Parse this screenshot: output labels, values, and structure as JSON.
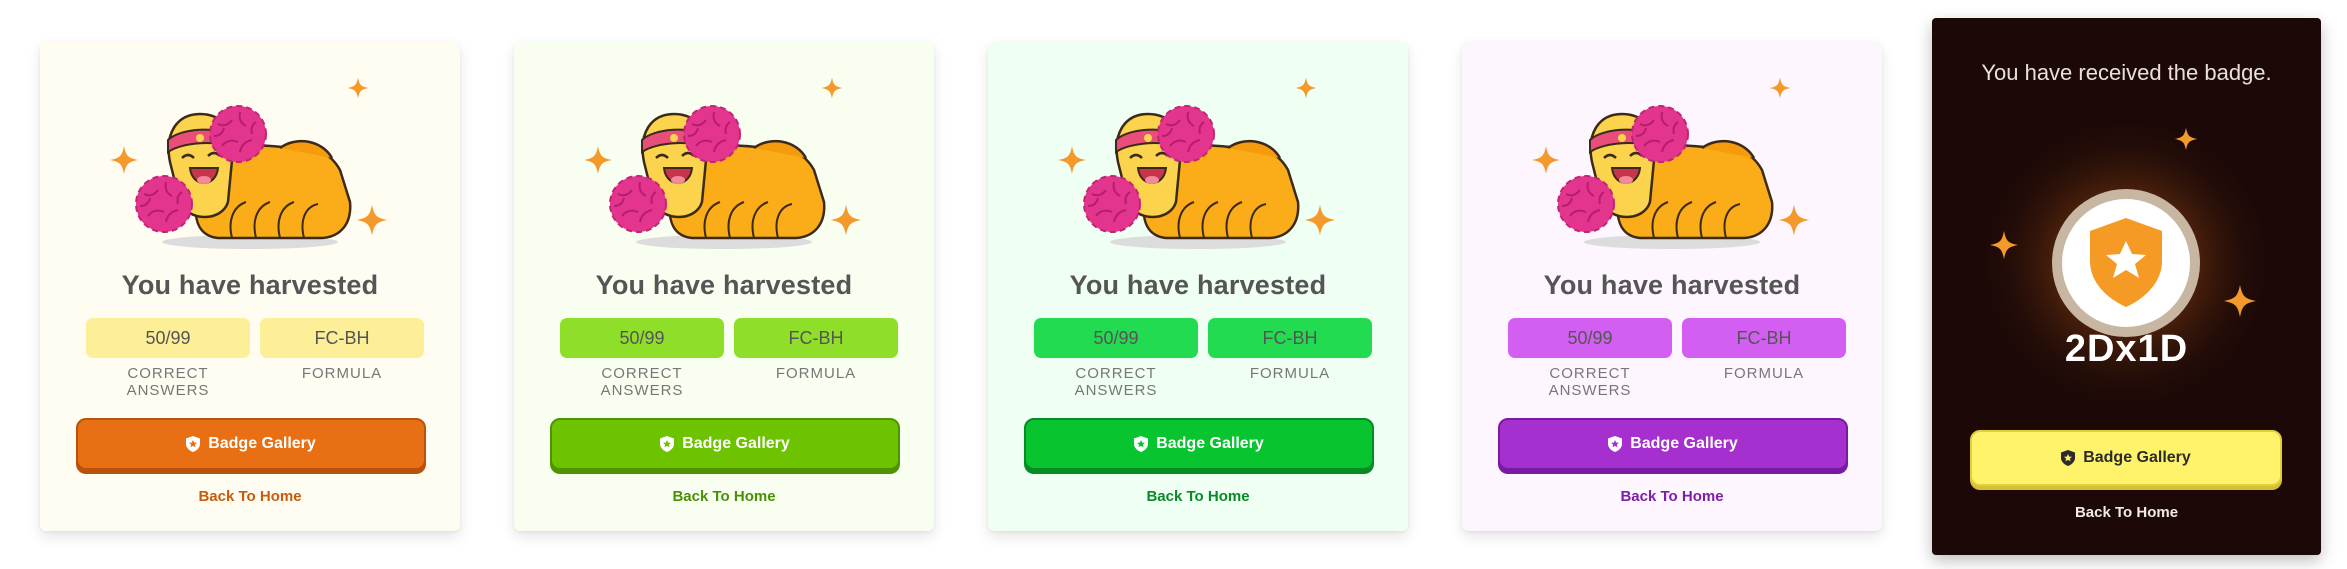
{
  "cards": [
    {
      "title": "You have harvested",
      "correct_value": "50/99",
      "correct_caption": "CORRECT ANSWERS",
      "formula_value": "FC-BH",
      "formula_caption": "FORMULA",
      "button_label": "Badge Gallery",
      "link_label": "Back To Home",
      "accent": "#e96f14"
    },
    {
      "title": "You have harvested",
      "correct_value": "50/99",
      "correct_caption": "CORRECT ANSWERS",
      "formula_value": "FC-BH",
      "formula_caption": "FORMULA",
      "button_label": "Badge Gallery",
      "link_label": "Back To Home",
      "accent": "#6dc300"
    },
    {
      "title": "You have harvested",
      "correct_value": "50/99",
      "correct_caption": "CORRECT ANSWERS",
      "formula_value": "FC-BH",
      "formula_caption": "FORMULA",
      "button_label": "Badge Gallery",
      "link_label": "Back To Home",
      "accent": "#07c42f"
    },
    {
      "title": "You have harvested",
      "correct_value": "50/99",
      "correct_caption": "CORRECT ANSWERS",
      "formula_value": "FC-BH",
      "formula_caption": "FORMULA",
      "button_label": "Badge Gallery",
      "link_label": "Back To Home",
      "accent": "#a62fcf"
    }
  ],
  "badge_card": {
    "title": "You have received the badge.",
    "badge_code": "2Dx1D",
    "button_label": "Badge Gallery",
    "link_label": "Back To Home",
    "accent": "#fff36b",
    "icon": "shield-star-icon"
  }
}
